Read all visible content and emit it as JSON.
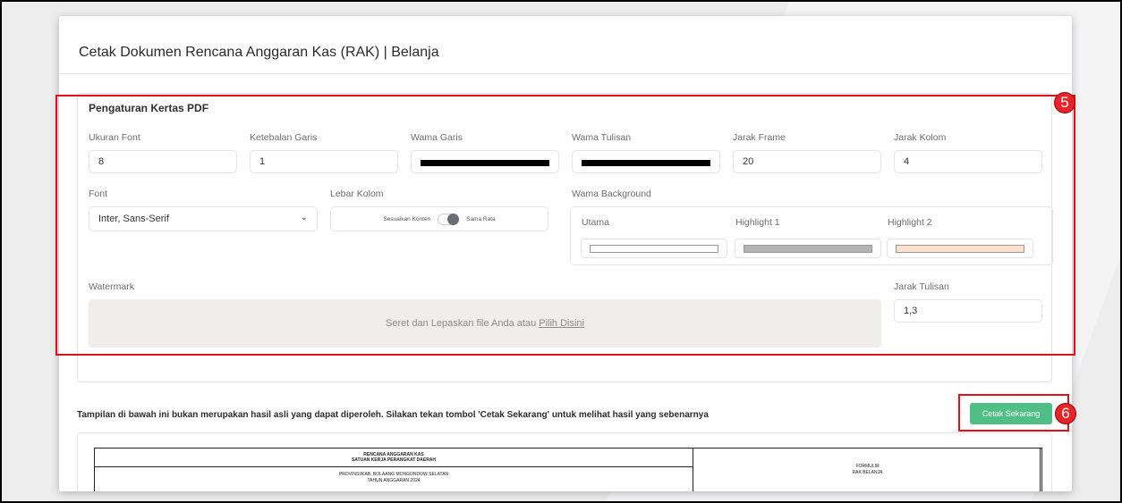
{
  "card": {
    "title": "Cetak Dokumen Rencana Anggaran Kas (RAK) | Belanja"
  },
  "settings": {
    "section_title": "Pengaturan Kertas PDF",
    "ukuran_font": {
      "label": "Ukuran Font",
      "value": "8"
    },
    "ketebalan_garis": {
      "label": "Ketebalan Garis",
      "value": "1"
    },
    "warna_garis": {
      "label": "Wama Garis",
      "color": "#000000"
    },
    "warna_tulisan": {
      "label": "Wama Tulisan",
      "color": "#000000"
    },
    "jarak_frame": {
      "label": "Jarak Frame",
      "value": "20"
    },
    "jarak_kolom": {
      "label": "Jarak Kolom",
      "value": "4"
    },
    "font": {
      "label": "Font",
      "value": "Inter, Sans-Serif"
    },
    "lebar_kolom": {
      "label": "Lebar Kolom",
      "option_left": "Sesuaikan Konten",
      "option_right": "Sama Rata"
    },
    "warna_background": {
      "label": "Wama Background",
      "utama": {
        "label": "Utama",
        "color": "#ffffff"
      },
      "highlight1": {
        "label": "Highlight 1",
        "color": "#b4b4b4"
      },
      "highlight2": {
        "label": "Highlight 2",
        "color": "#fbe0cc"
      }
    },
    "watermark": {
      "label": "Watermark",
      "drop_text": "Seret dan Lepaskan file Anda atau ",
      "drop_link": "Pilih Disini"
    },
    "jarak_tulisan": {
      "label": "Jarak Tulisan",
      "value": "1,3"
    }
  },
  "annotations": {
    "badge5": "5",
    "badge6": "6",
    "highlight_color": "#e3101b"
  },
  "notice": "Tampilan di bawah ini bukan merupakan hasil asli yang dapat diperoleh. Silakan tekan tombol 'Cetak Sekarang' untuk melihat hasil yang sebenarnya",
  "print_button": {
    "label": "Cetak Sekarang",
    "color": "#4fbf85"
  },
  "preview": {
    "line1": "RENCANA ANGGARAN KAS",
    "line2": "SATUAN KERJA PERANGKAT DAERAH",
    "line3": "PROVINSI/KAB. BOLAANG MONGONDOW SELATAN",
    "line4": "TAHUN ANGGARAN 2024",
    "right1": "FORMULIR",
    "right2": "RAK BELANJA"
  }
}
